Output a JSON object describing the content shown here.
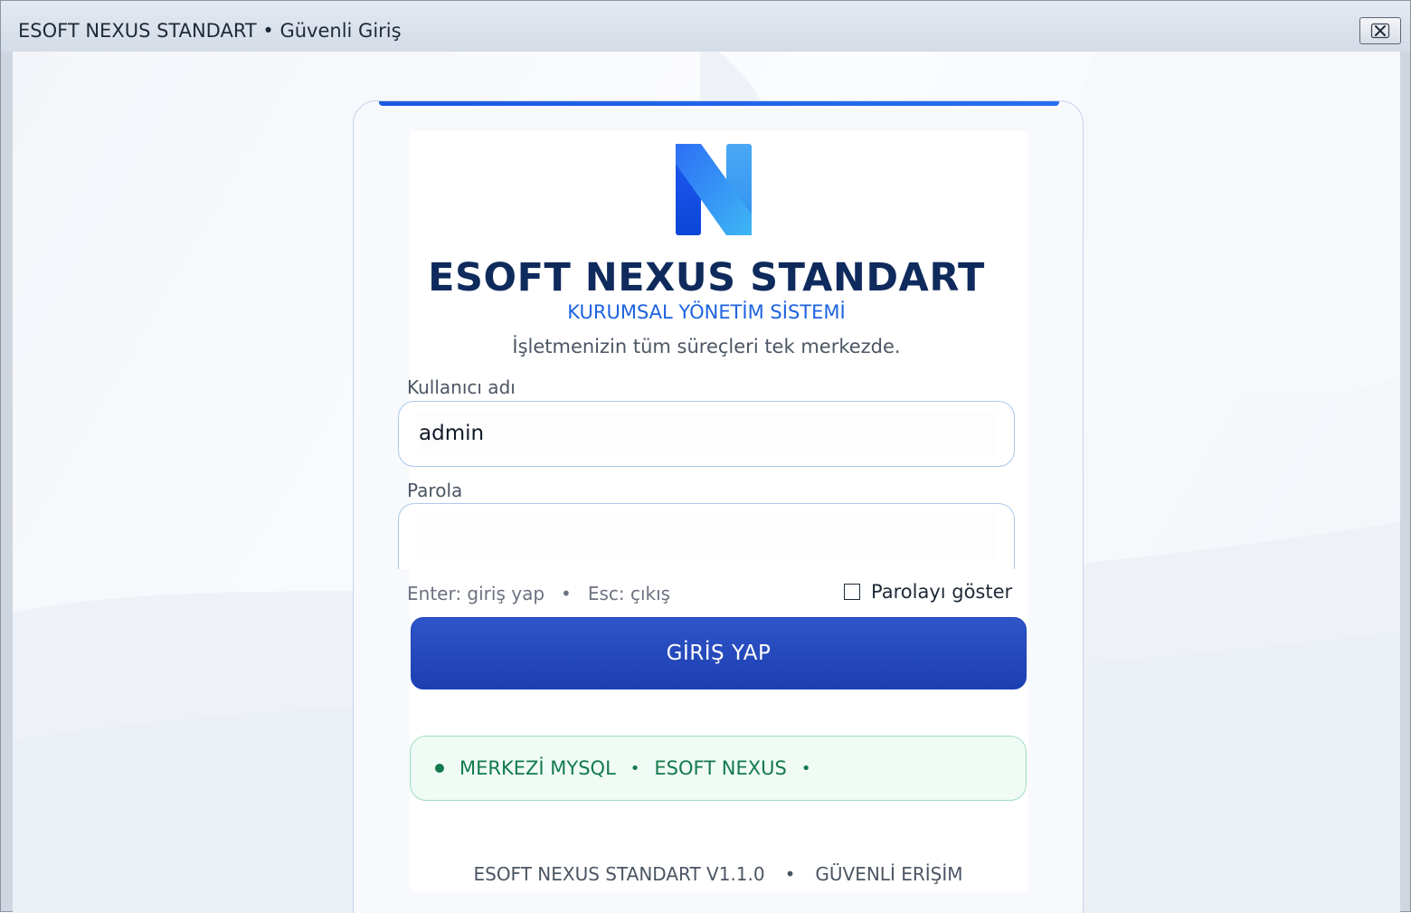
{
  "window": {
    "title": "ESOFT NEXUS STANDART • Güvenli Giriş",
    "close_icon": "close-icon"
  },
  "brand": {
    "title": "ESOFT NEXUS STANDART",
    "subtitle": "KURUMSAL YÖNETİM SİSTEMİ",
    "tagline": "İşletmenizin tüm süreçleri tek merkezde.",
    "logo_icon": "nexus-logo-n",
    "accent_color": "#1d63e0",
    "title_color": "#0f2a5c"
  },
  "form": {
    "username_label": "Kullanıcı adı",
    "username_value": "admin",
    "password_label": "Parola",
    "password_value": "",
    "hint_enter": "Enter: giriş yap",
    "hint_separator": "•",
    "hint_esc": "Esc: çıkış",
    "show_password_label": "Parolayı göster",
    "show_password_checked": false,
    "submit_label": "GİRİŞ YAP",
    "submit_color": "#2548bd"
  },
  "status": {
    "items": [
      "MERKEZİ MYSQL",
      "ESOFT NEXUS"
    ],
    "separator": "•",
    "color": "#127a4c"
  },
  "footer": {
    "version": "ESOFT NEXUS STANDART V1.1.0",
    "separator": "•",
    "security": "GÜVENLİ ERİŞİM"
  }
}
